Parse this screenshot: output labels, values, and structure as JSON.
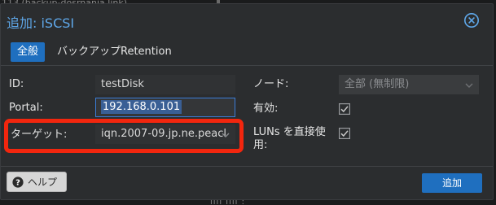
{
  "background": {
    "top_text": "113 (backup-dosrnania link)",
    "bottom_text": "ıııı ıııı :"
  },
  "dialog": {
    "title": "追加: iSCSI",
    "tabs": [
      {
        "label": "全般",
        "active": true
      },
      {
        "label": "バックアップRetention",
        "active": false
      }
    ],
    "fields": {
      "id": {
        "label": "ID:",
        "value": "testDisk"
      },
      "portal": {
        "label": "Portal:",
        "value": "192.168.0.101"
      },
      "target": {
        "label": "ターゲット:",
        "value": "iqn.2007-09.jp.ne.peacl"
      },
      "node": {
        "label": "ノード:",
        "value": "全部 (無制限)"
      },
      "enabled": {
        "label": "有効:",
        "checked": true
      },
      "luns_direct": {
        "label_line1": "LUNs を直接使",
        "label_line2": "用:",
        "checked": true
      }
    },
    "help_label": "ヘルプ",
    "add_label": "追加"
  },
  "colors": {
    "accent": "#1f6fbf",
    "title": "#5fa8ea",
    "highlight": "#f2260e"
  },
  "icons": {
    "close": "close-circle-icon",
    "help": "question-circle-icon",
    "checkbox": "check-icon",
    "dropdown": "chevron-down-icon"
  }
}
